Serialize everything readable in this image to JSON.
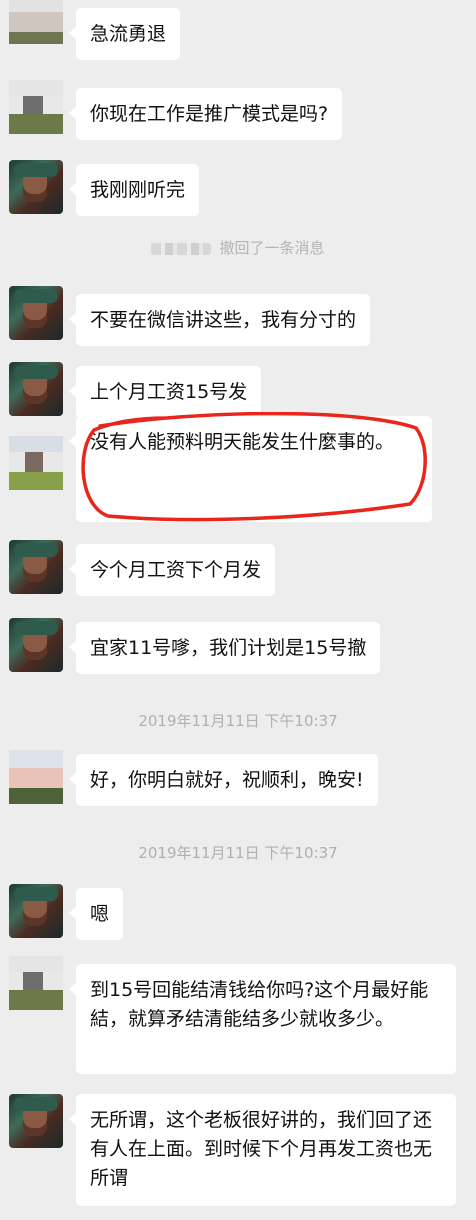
{
  "messages": [
    {
      "text": "急流勇退"
    },
    {
      "text": "你现在工作是推广模式是吗?"
    },
    {
      "text": "我刚刚听完"
    },
    {
      "text": "不要在微信讲这些，我有分寸的"
    },
    {
      "text": "上个月工资15号发"
    },
    {
      "text": "没有人能预料明天能发生什麼事的。"
    },
    {
      "text": "今个月工资下个月发"
    },
    {
      "text": "宜家11号嗲，我们计划是15号撤"
    },
    {
      "text": "好，你明白就好，祝顺利，晚安!"
    },
    {
      "text": "嗯"
    },
    {
      "text": "到15号回能结清钱给你吗?这个月最好能結，就算矛结清能结多少就收多少。"
    },
    {
      "text": "无所谓，这个老板很好讲的，我们回了还有人在上面。到时候下个月再发工资也无所谓"
    }
  ],
  "recall_notice": "撤回了一条消息",
  "timestamps": [
    "2019年11月11日 下午10:37",
    "2019年11月11日 下午10:37"
  ],
  "colors": {
    "background": "#ededed",
    "bubble": "#ffffff",
    "annotation": "#e8261c"
  }
}
